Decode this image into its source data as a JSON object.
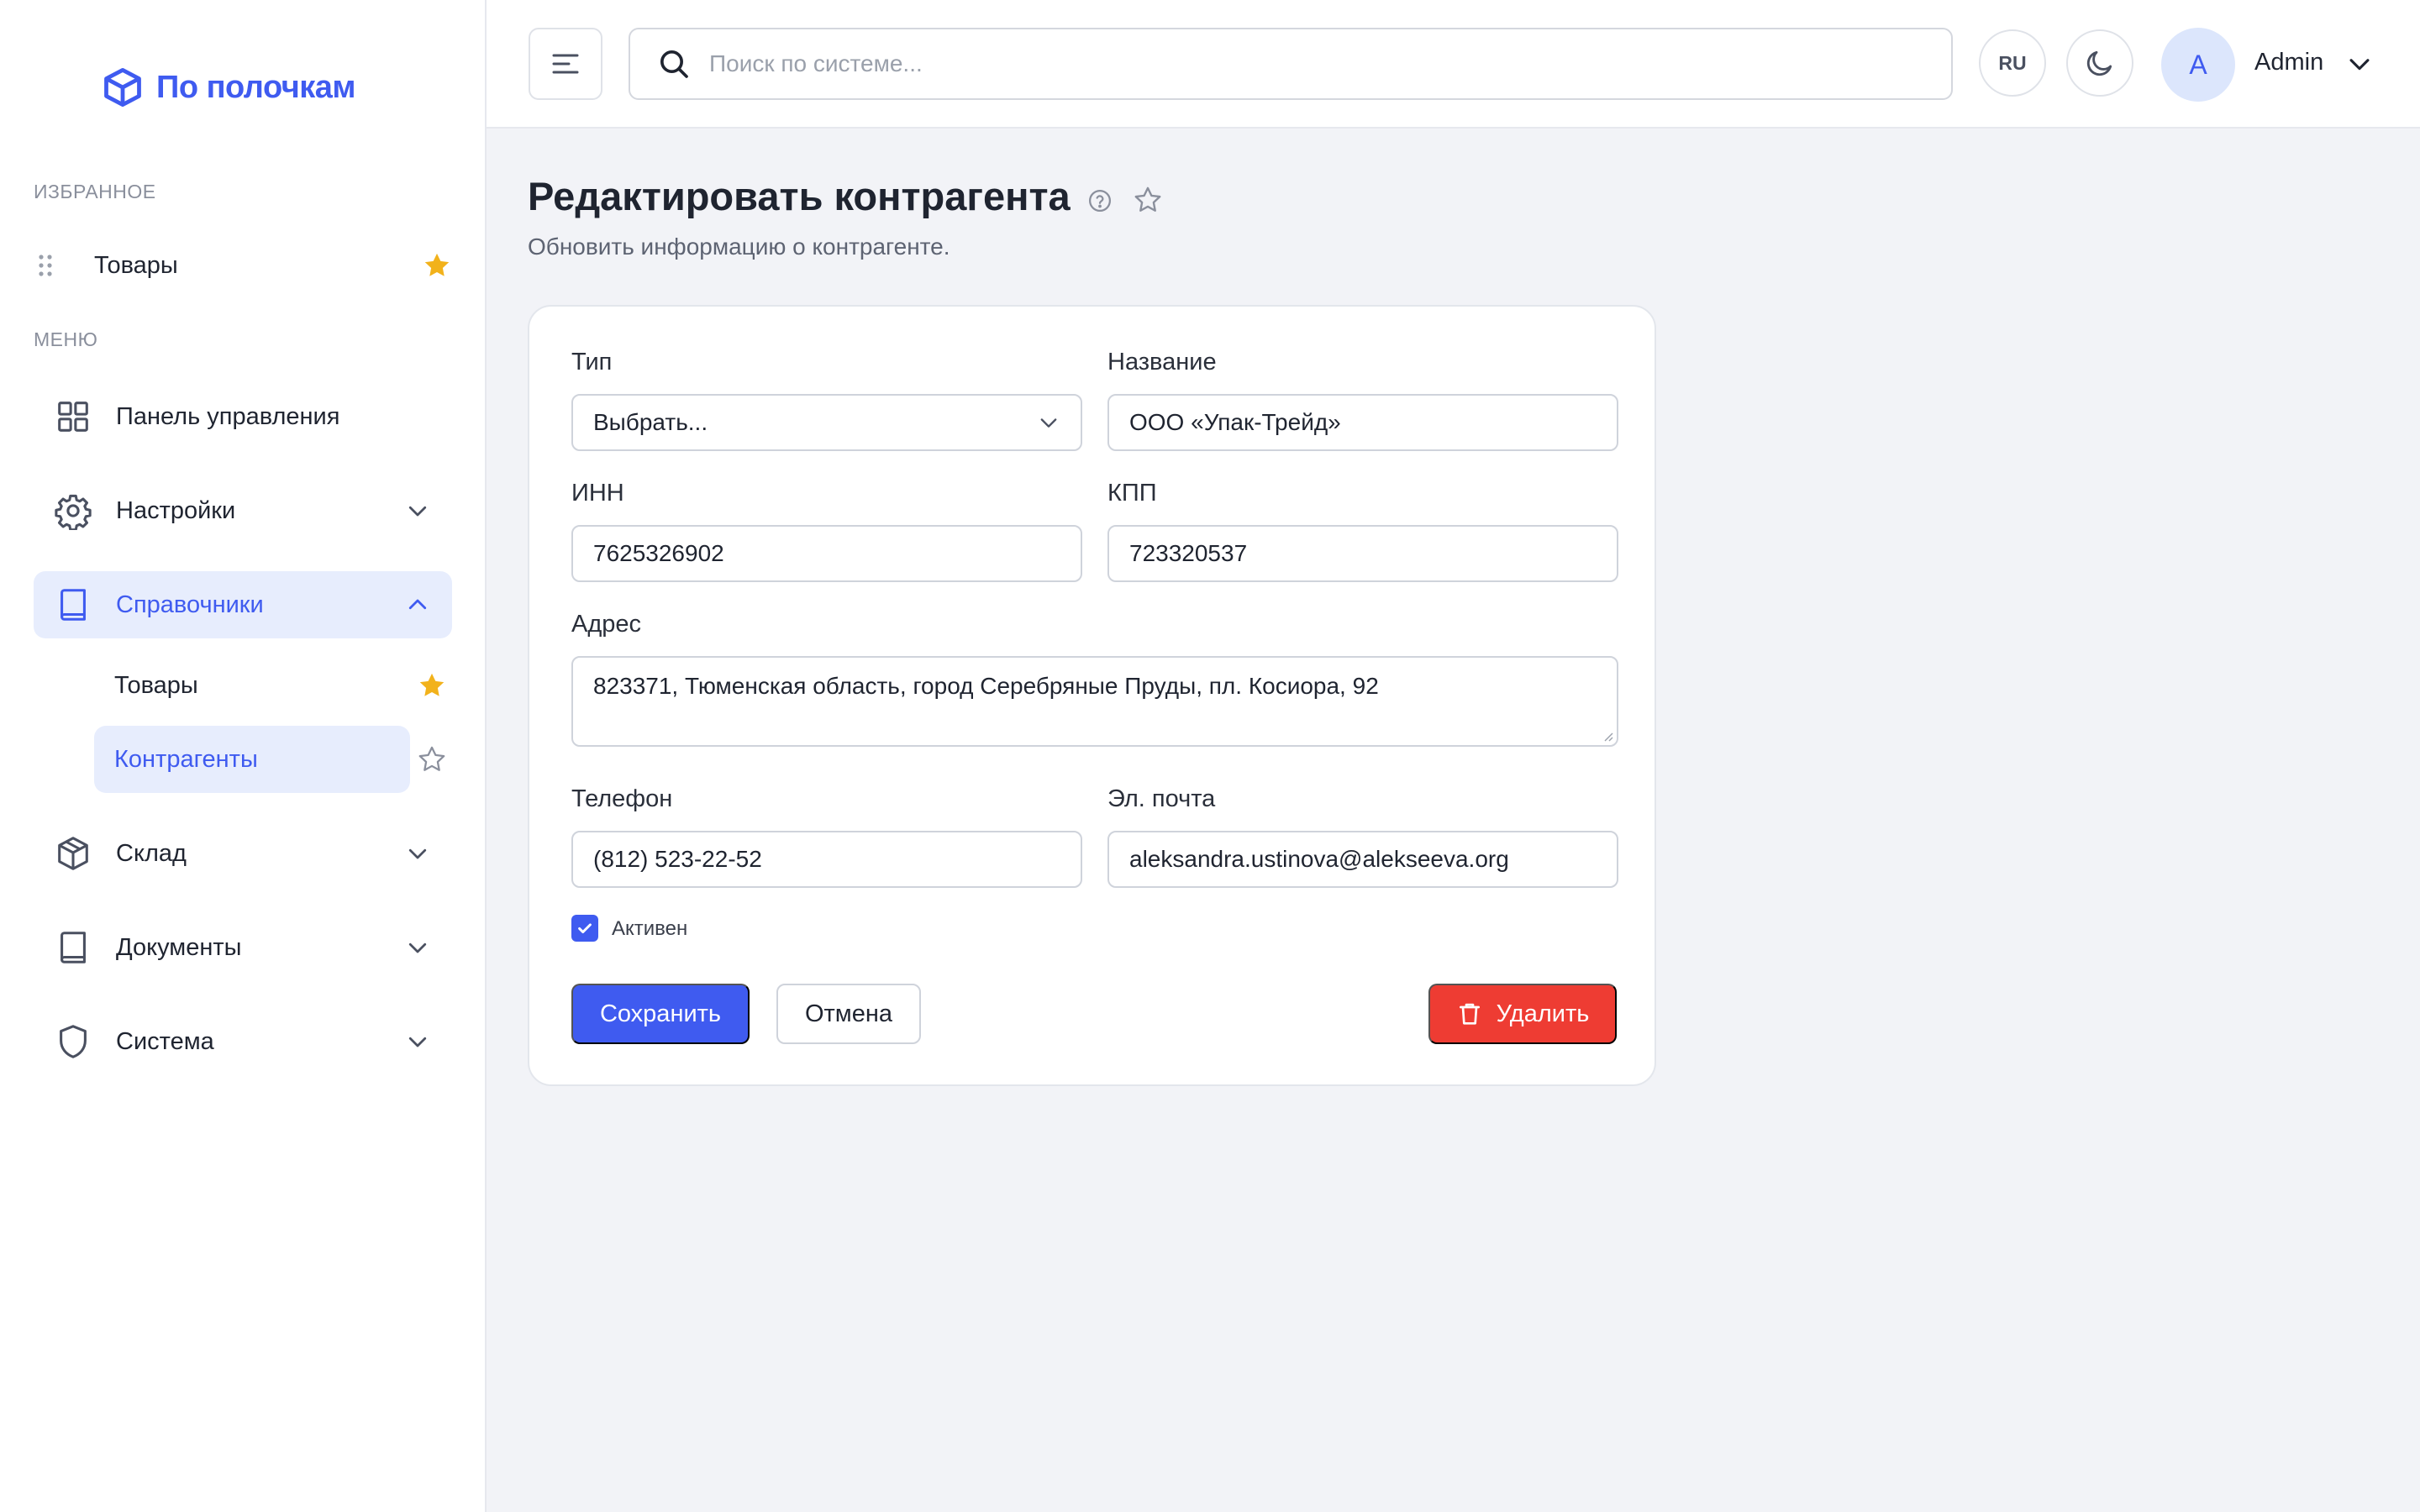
{
  "app": {
    "brand": "По полочкам",
    "brand_color": "#3f5bf0"
  },
  "sidebar": {
    "favorites_label": "ИЗБРАННОЕ",
    "favorites": [
      {
        "label": "Товары",
        "icon": "star-filled-icon"
      }
    ],
    "menu_label": "МЕНЮ",
    "items": [
      {
        "label": "Панель управления",
        "icon": "dashboard-grid-icon"
      },
      {
        "label": "Настройки",
        "icon": "gear-icon",
        "expanded": false
      },
      {
        "label": "Справочники",
        "icon": "book-icon",
        "expanded": true,
        "active": true
      },
      {
        "label": "Склад",
        "icon": "box-icon",
        "expanded": false
      },
      {
        "label": "Документы",
        "icon": "book-icon",
        "expanded": false
      },
      {
        "label": "Система",
        "icon": "shield-icon",
        "expanded": false
      }
    ],
    "subitems": [
      {
        "label": "Товары",
        "favorite": true
      },
      {
        "label": "Контрагенты",
        "favorite": false,
        "active": true
      }
    ]
  },
  "topbar": {
    "search_placeholder": "Поиск по системе...",
    "lang": "RU",
    "avatar_letter": "A",
    "user_name": "Admin"
  },
  "page": {
    "title": "Редактировать контрагента",
    "subtitle": "Обновить информацию о контрагенте."
  },
  "form": {
    "type_label": "Тип",
    "type_value": "Выбрать...",
    "name_label": "Название",
    "name_value": "ООО «Упак-Трейд»",
    "inn_label": "ИНН",
    "inn_value": "7625326902",
    "kpp_label": "КПП",
    "kpp_value": "723320537",
    "address_label": "Адрес",
    "address_value": "823371, Тюменская область, город Серебряные Пруды, пл. Косиора, 92",
    "phone_label": "Телефон",
    "phone_value": "(812) 523-22-52",
    "email_label": "Эл. почта",
    "email_value": "aleksandra.ustinova@alekseeva.org",
    "active_label": "Активен",
    "active_checked": true,
    "save_label": "Сохранить",
    "cancel_label": "Отмена",
    "delete_label": "Удалить"
  },
  "colors": {
    "accent": "#3f5bf0",
    "danger": "#ee3c33",
    "star": "#f2b21b",
    "active_bg": "#e7edfd"
  }
}
